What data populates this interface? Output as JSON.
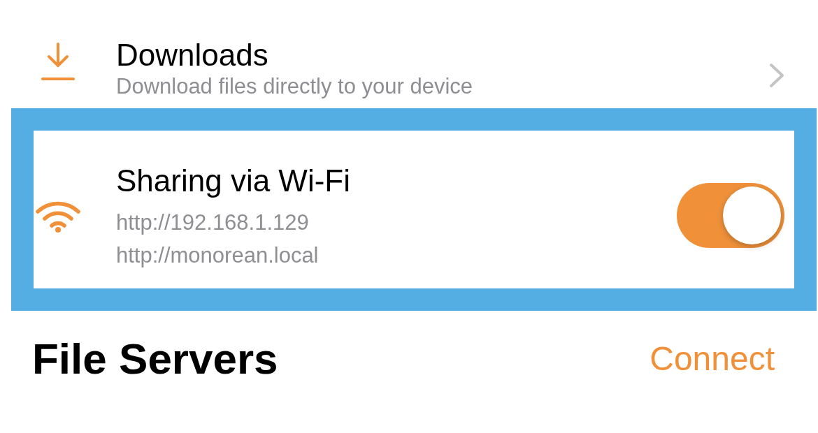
{
  "rows": [
    {
      "kind": "link",
      "title": "Downloads",
      "subtitle": "Download files directly to your device",
      "highlighted": false
    },
    {
      "kind": "toggle",
      "title": "Sharing via Wi-Fi",
      "lines": [
        "http://192.168.1.129",
        "http://monorean.local"
      ],
      "on": true,
      "highlighted": true
    }
  ],
  "section": {
    "title": "File Servers",
    "action": "Connect"
  }
}
